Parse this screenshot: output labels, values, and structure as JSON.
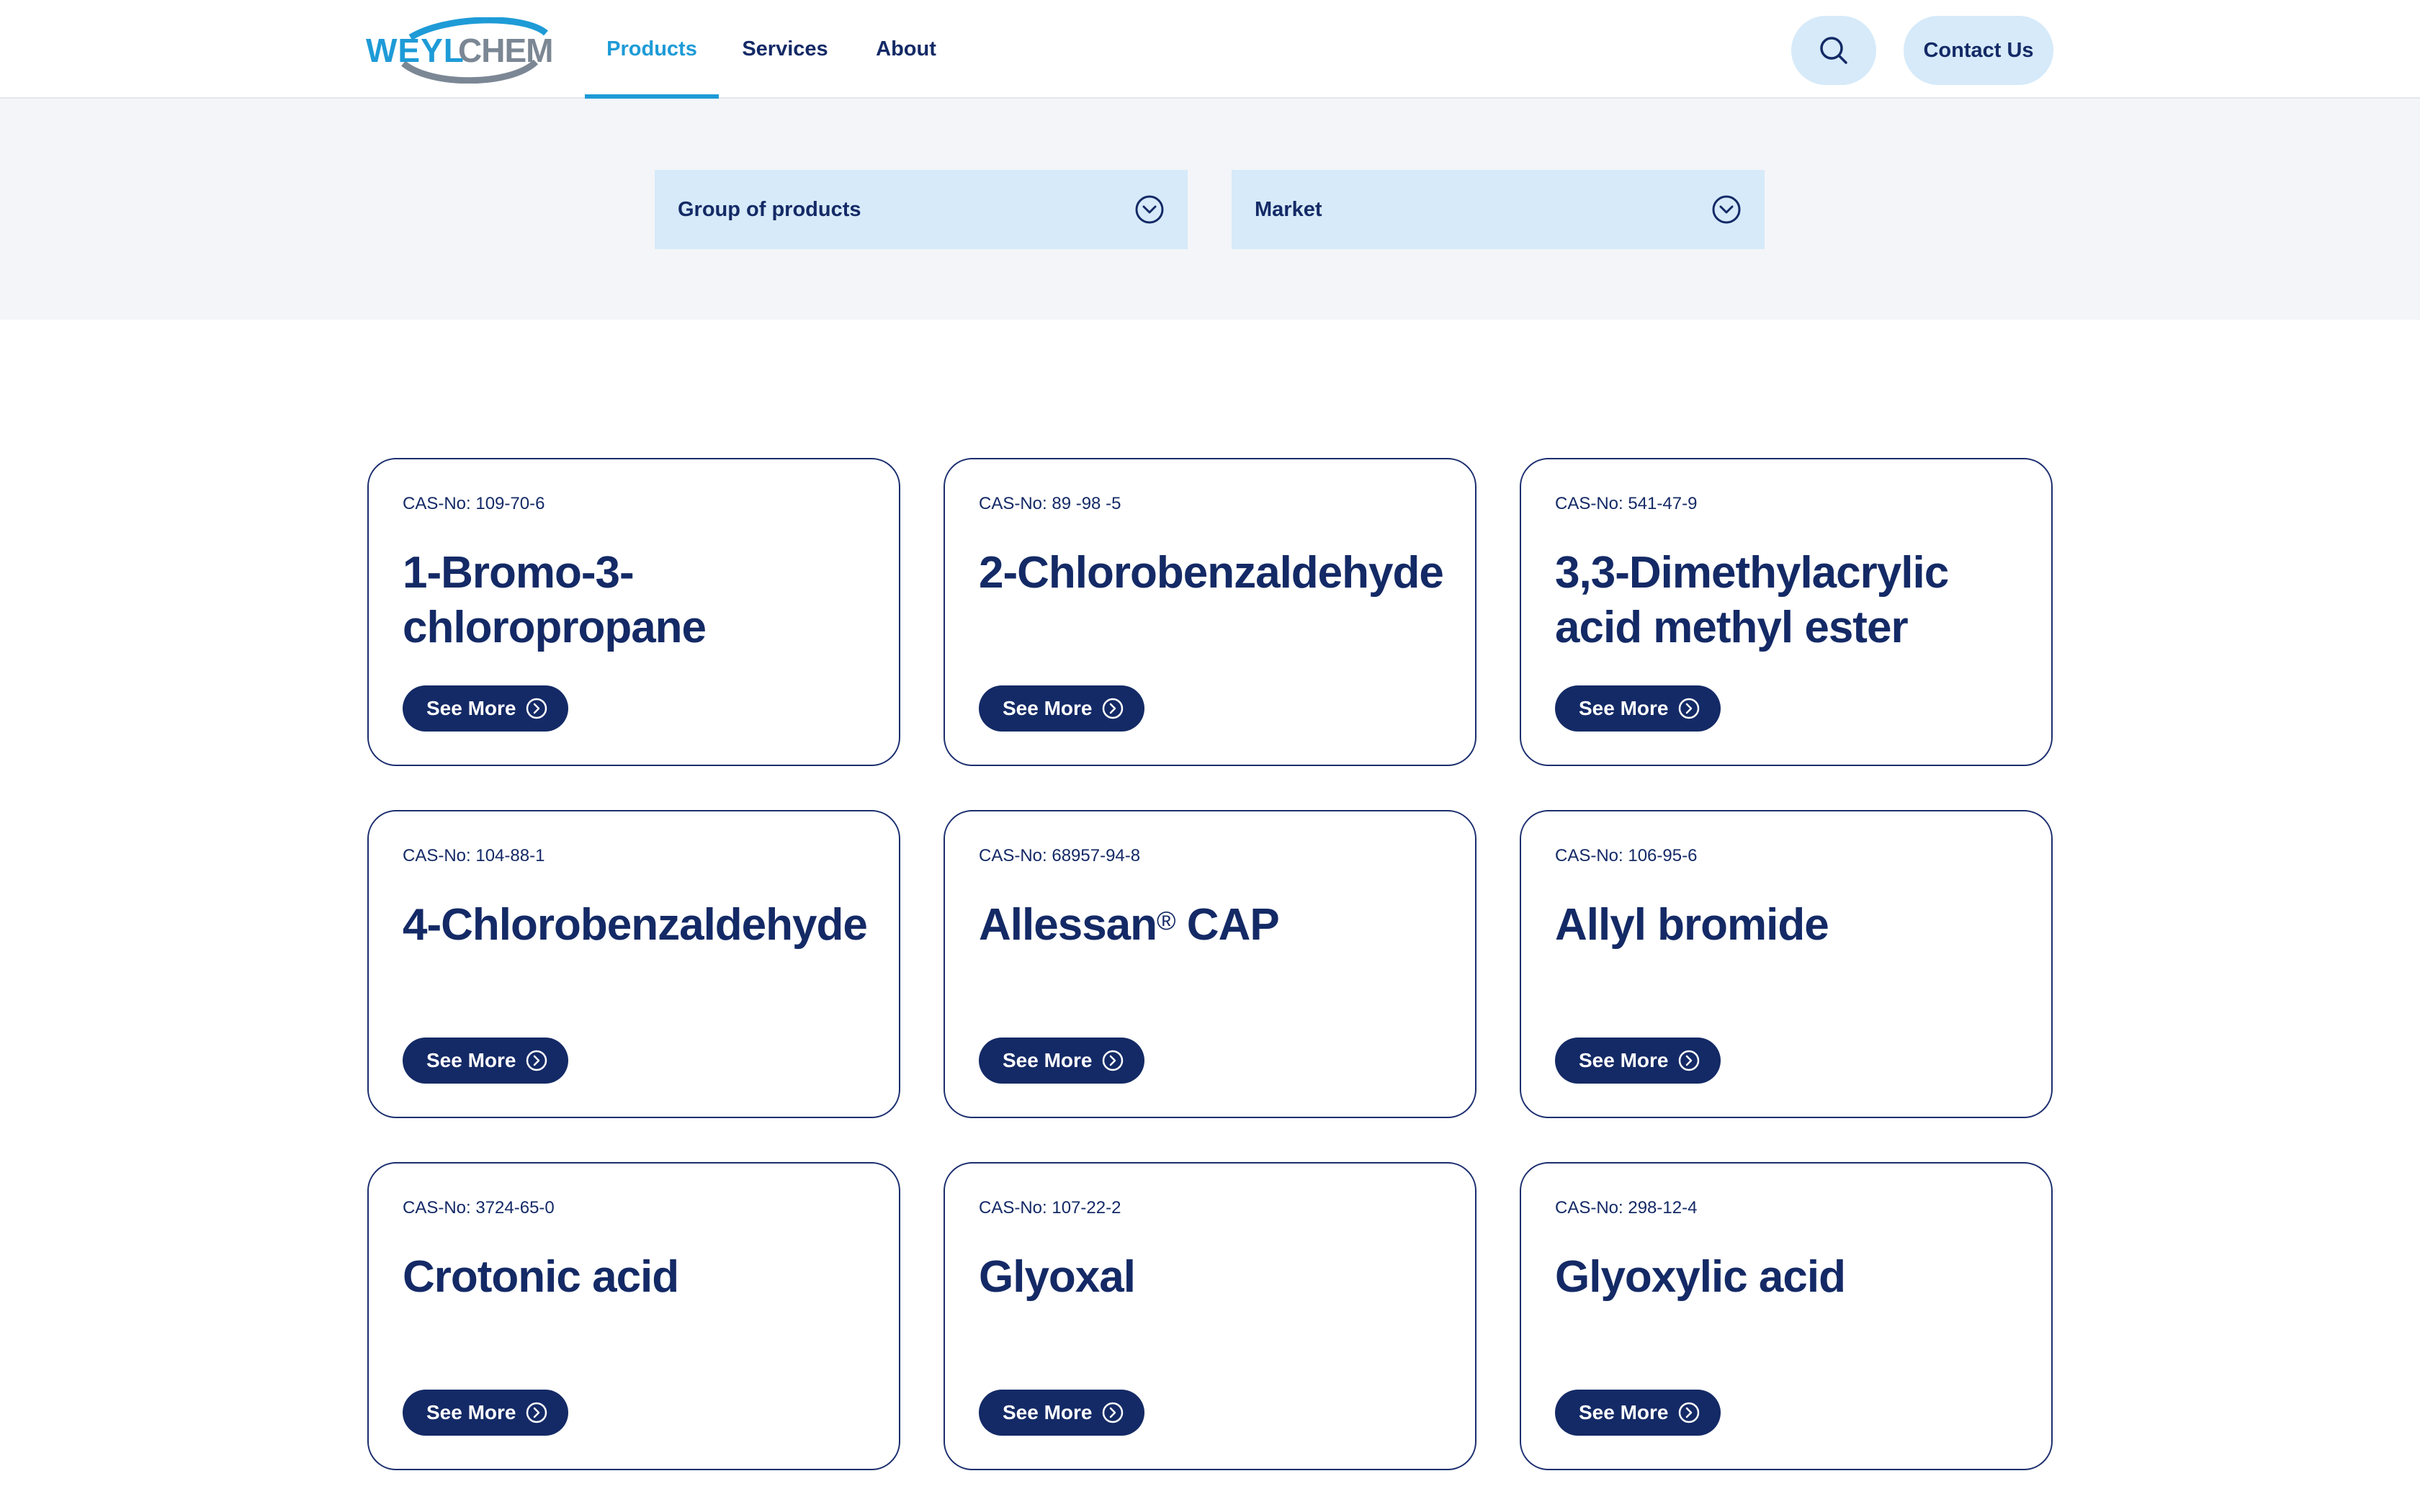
{
  "brand": {
    "logo_text": "WEYLCHEM",
    "logo_part1": "WEYL",
    "logo_part2": "CHEM",
    "primary_color": "#142a66",
    "accent_color": "#1e9bd7",
    "light_color": "#d6eaf9"
  },
  "nav": {
    "items": [
      {
        "label": "Products",
        "active": true
      },
      {
        "label": "Services",
        "active": false
      },
      {
        "label": "About",
        "active": false
      }
    ]
  },
  "header": {
    "search_icon": "search-icon",
    "contact_label": "Contact Us"
  },
  "filters": {
    "group": "Group of products",
    "market": "Market"
  },
  "cards": [
    {
      "cas": "CAS-No: 109-70-6",
      "name": "1-Bromo-3-chloropropane",
      "cta": "See More"
    },
    {
      "cas": "CAS-No: 89 -98 -5",
      "name": "2-Chlorobenzaldehyde",
      "cta": "See More"
    },
    {
      "cas": "CAS-No: 541-47-9",
      "name": "3,3-Dimethylacrylic acid methyl ester",
      "cta": "See More"
    },
    {
      "cas": "CAS-No: 104-88-1",
      "name": "4-Chlorobenzaldehyde",
      "cta": "See More"
    },
    {
      "cas": "CAS-No: 68957-94-8",
      "name": "Allessan",
      "name_suffix": "®",
      "name_tail": " CAP",
      "cta": "See More"
    },
    {
      "cas": "CAS-No: 106-95-6",
      "name": "Allyl bromide",
      "cta": "See More"
    },
    {
      "cas": "CAS-No: 3724-65-0",
      "name": "Crotonic acid",
      "cta": "See More"
    },
    {
      "cas": "CAS-No: 107-22-2",
      "name": "Glyoxal",
      "cta": "See More"
    },
    {
      "cas": "CAS-No: 298-12-4",
      "name": "Glyoxylic acid",
      "cta": "See More"
    }
  ]
}
